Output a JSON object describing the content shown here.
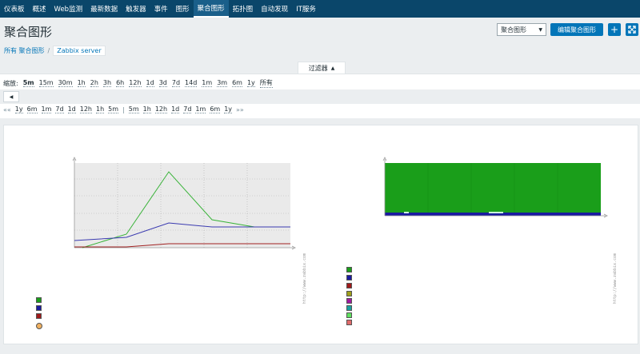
{
  "nav": {
    "items": [
      {
        "label": "仪表板",
        "active": false
      },
      {
        "label": "概述",
        "active": false
      },
      {
        "label": "Web监测",
        "active": false
      },
      {
        "label": "最新数据",
        "active": false
      },
      {
        "label": "触发器",
        "active": false
      },
      {
        "label": "事件",
        "active": false
      },
      {
        "label": "图形",
        "active": false
      },
      {
        "label": "聚合图形",
        "active": true
      },
      {
        "label": "拓扑图",
        "active": false
      },
      {
        "label": "自动发现",
        "active": false
      },
      {
        "label": "IT服务",
        "active": false
      }
    ]
  },
  "header": {
    "title": "聚合图形",
    "view_select": "聚合图形",
    "edit_button": "编辑聚合图形",
    "add_icon": "plus-icon",
    "fullscreen_icon": "fullscreen-icon"
  },
  "breadcrumb": {
    "all": "所有 聚合图形",
    "separator": "/",
    "current": "Zabbix server"
  },
  "filter": {
    "tab_label": "过滤器",
    "tab_icon": "caret-up-icon",
    "zoom_label": "缩放:",
    "zoom_options": [
      "5m",
      "15m",
      "30m",
      "1h",
      "2h",
      "3h",
      "6h",
      "12h",
      "1d",
      "3d",
      "7d",
      "14d",
      "1m",
      "3m",
      "6m",
      "1y",
      "所有"
    ],
    "prev_icon": "caret-left-icon",
    "nav_prev_marker": "««",
    "nav_back": [
      "1y",
      "6m",
      "1m",
      "7d",
      "1d",
      "12h",
      "1h",
      "5m"
    ],
    "nav_separator": "|",
    "nav_forward": [
      "5m",
      "1h",
      "12h",
      "1d",
      "7d",
      "1m",
      "6m",
      "1y"
    ],
    "nav_next_marker": "»»"
  },
  "graphs": {
    "watermark": "http://www.zabbix.com",
    "colors": {
      "green": "#1a9e1a",
      "blue": "#1a1aa0",
      "red": "#a01a1a",
      "olive": "#a0a01a",
      "purple": "#a01aa0",
      "teal": "#1aa0a0",
      "lightgreen": "#5ee05e",
      "salmon": "#e06b6b",
      "orange": "#f0b060"
    }
  }
}
